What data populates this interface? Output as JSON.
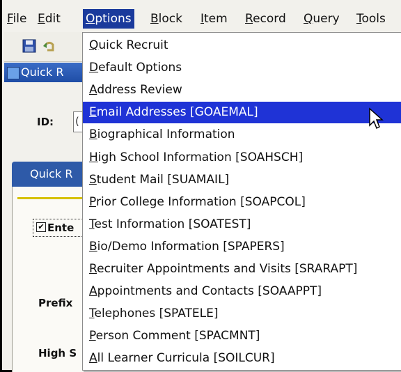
{
  "menubar": {
    "items": [
      {
        "label": "File",
        "accel_index": 0
      },
      {
        "label": "Edit",
        "accel_index": 0
      },
      {
        "label": "Options",
        "accel_index": 0,
        "active": true
      },
      {
        "label": "Block",
        "accel_index": 0
      },
      {
        "label": "Item",
        "accel_index": 0
      },
      {
        "label": "Record",
        "accel_index": 0
      },
      {
        "label": "Query",
        "accel_index": 0
      },
      {
        "label": "Tools",
        "accel_index": 0
      }
    ]
  },
  "toolbar": {
    "icons": [
      "save-icon",
      "rollback-icon"
    ]
  },
  "window": {
    "title": "Quick R"
  },
  "form": {
    "id_label": "ID:",
    "id_value": "(",
    "tab_label": "Quick R",
    "checkbox_label": "Ente",
    "checkbox_checked": true,
    "prefix_label": "Prefix",
    "highschool_label": "High S"
  },
  "options_menu": {
    "highlighted_index": 3,
    "items": [
      {
        "label": "Quick Recruit",
        "accel_index": 0
      },
      {
        "label": "Default Options",
        "accel_index": 0
      },
      {
        "label": "Address Review",
        "accel_index": 0
      },
      {
        "label": "Email Addresses [GOAEMAL]",
        "accel_index": 0
      },
      {
        "label": "Biographical Information",
        "accel_index": 0
      },
      {
        "label": "High School Information [SOAHSCH]",
        "accel_index": 0
      },
      {
        "label": "Student Mail [SUAMAIL]",
        "accel_index": 0
      },
      {
        "label": "Prior College Information [SOAPCOL]",
        "accel_index": 0
      },
      {
        "label": "Test Information [SOATEST]",
        "accel_index": 0
      },
      {
        "label": "Bio/Demo Information [SPAPERS]",
        "accel_index": 0
      },
      {
        "label": "Recruiter Appointments and Visits [SRARAPT]",
        "accel_index": 0
      },
      {
        "label": "Appointments and Contacts [SOAAPPT]",
        "accel_index": 0
      },
      {
        "label": "Telephones [SPATELE]",
        "accel_index": 0
      },
      {
        "label": "Person Comment [SPACMNT]",
        "accel_index": 0
      },
      {
        "label": "All Learner Curricula [SOILCUR]",
        "accel_index": 0
      }
    ]
  },
  "colors": {
    "menu_active_bg": "#1a3a9c",
    "menu_highlight_bg": "#1f33d6",
    "title_bar": "#2e5aa8"
  }
}
